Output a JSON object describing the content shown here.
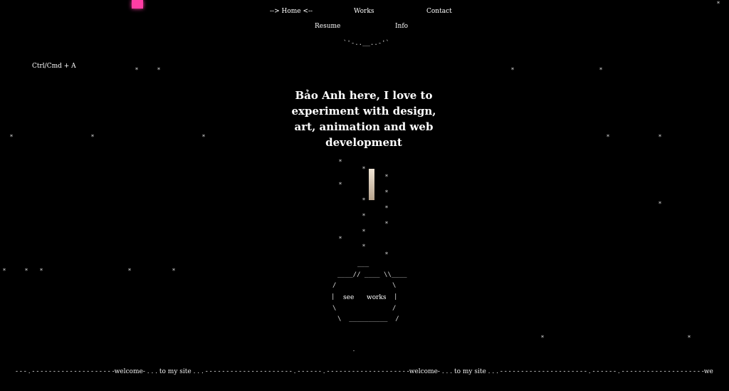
{
  "nav": {
    "home": "--> Home <--",
    "works": "Works",
    "contact": "Contact",
    "resume": "Resume",
    "info": "Info"
  },
  "shortcut_hint": "Ctrl/Cmd + A",
  "headline": "Bảo Anh here, I love to experiment with design, art, animation and web development",
  "ascii": {
    "top_wave": "`'-..__..-'`",
    "pot_lid": "___",
    "pot_top": "____// ____ \\\\____",
    "pot_side_left_1": "/",
    "pot_side_right_1": "\\",
    "pot_side_left_2": "|",
    "pot_side_right_2": "|",
    "pot_side_left_3": "\\",
    "pot_side_right_3": "/",
    "pot_bottom": "\\  __________  /"
  },
  "pot_labels": {
    "see": "see",
    "works": "works"
  },
  "bottom_ticker": "- - - . - - - - - - - - - - - - - - - - - - - -welcome- . . . to my site . . . - - - - - - - - - - - - - - - - - - - - - . - - - - - - . - - - - - - - - - - - - - - - - - - - -welcome- . . . to my site . . . - - - - - - - - - - - - - - - - - - - - - . - - - - - - . - - - - - - - - - - - - - - - - - - - -welcome- . . . to my site . . . - - - - - - - - - - - - - - - - - - - - - . - - - - - - . - - - - - - - - - - - - - - - - - - - -welcome",
  "star_glyph": "*",
  "colors": {
    "accent": "#ff3ea5",
    "background": "#000000",
    "text": "#ffffff"
  }
}
